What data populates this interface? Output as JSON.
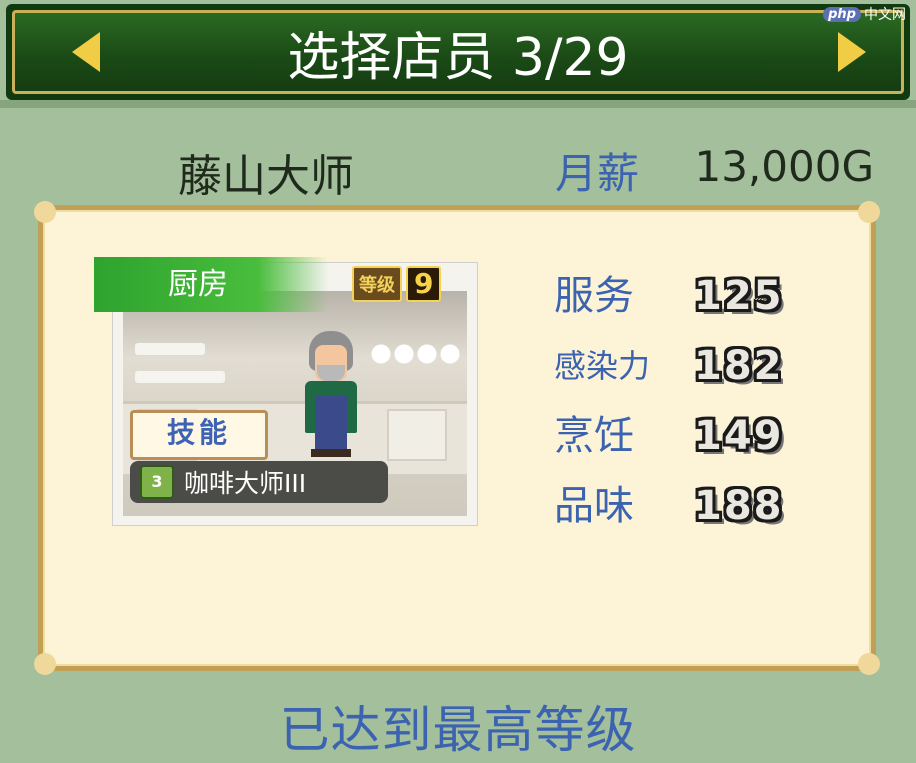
{
  "header": {
    "title": "选择店员 3/29",
    "watermark_logo": "php",
    "watermark_text": "中文网"
  },
  "staff": {
    "name": "藤山大师",
    "salary_label": "月薪",
    "salary_value": "13,000G",
    "department": "厨房",
    "level_label": "等级",
    "level_value": "9",
    "skill_tag": "技能",
    "skill_icon_glyph": "3",
    "skill_name": "咖啡大师III"
  },
  "stats": [
    {
      "label": "服务",
      "value": "125"
    },
    {
      "label": "感染力",
      "value": "182"
    },
    {
      "label": "烹饪",
      "value": "149"
    },
    {
      "label": "品味",
      "value": "188"
    }
  ],
  "footer": {
    "status": "已达到最高等级"
  },
  "colors": {
    "background": "#a3bf9c",
    "header": "#1b4b16",
    "accent_gold": "#f1cd45",
    "label_blue": "#3c63b0",
    "panel": "#fdf4d8"
  },
  "icons": [
    "arrow-left-icon",
    "arrow-right-icon",
    "skill-icon"
  ]
}
